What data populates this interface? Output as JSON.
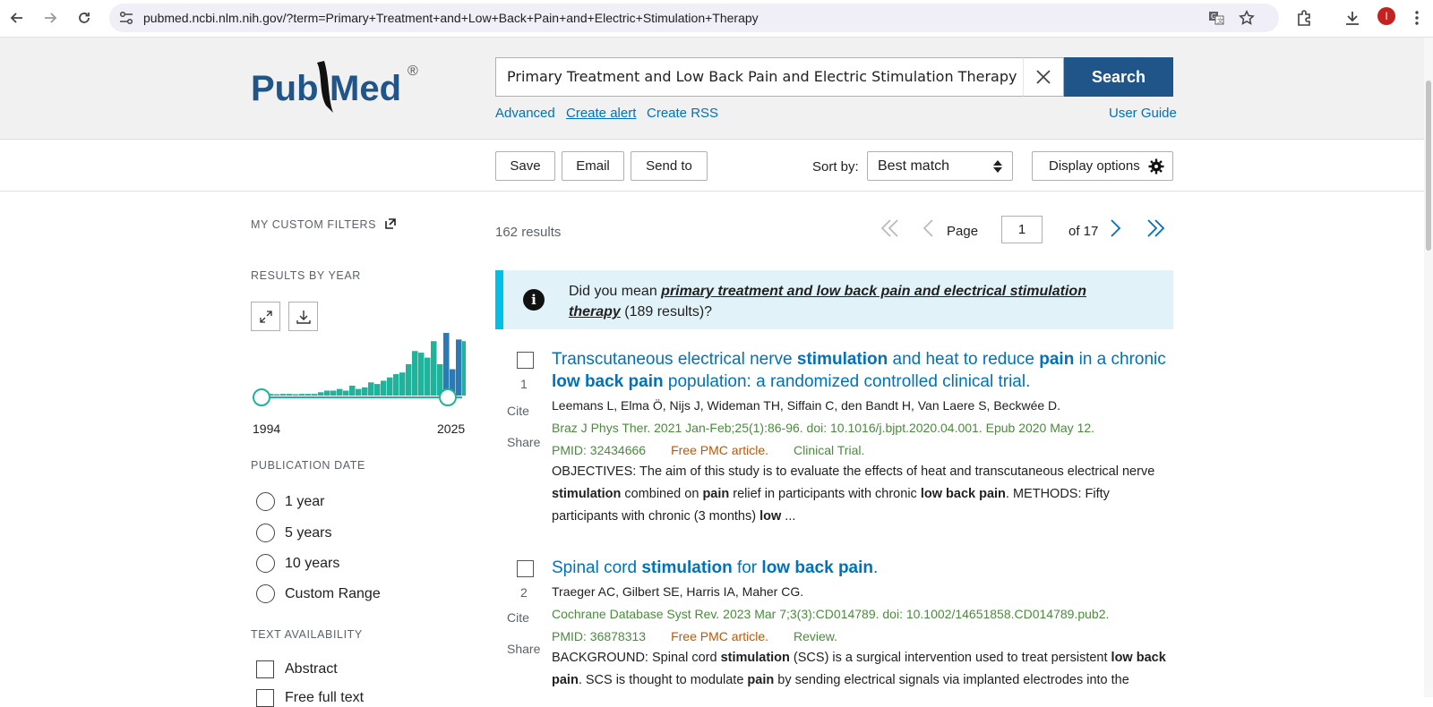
{
  "browser": {
    "url": "pubmed.ncbi.nlm.nih.gov/?term=Primary+Treatment+and+Low+Back+Pain+and+Electric+Stimulation+Therapy",
    "avatar_letter": "I"
  },
  "header": {
    "logo_pub": "Pub",
    "logo_med": "Med",
    "logo_reg": "®",
    "search_value": "Primary Treatment and Low Back Pain and Electric Stimulation Therapy",
    "search_button": "Search",
    "links": {
      "advanced": "Advanced",
      "create_alert": "Create alert",
      "create_rss": "Create RSS",
      "user_guide": "User Guide"
    }
  },
  "toolbar": {
    "save": "Save",
    "email": "Email",
    "send_to": "Send to",
    "sort_label": "Sort by:",
    "sort_value": "Best match",
    "display_options": "Display options"
  },
  "sidebar": {
    "custom_filters": "MY CUSTOM FILTERS",
    "results_by_year": "RESULTS BY YEAR",
    "year_start": "1994",
    "year_end": "2025",
    "histogram_counts": [
      0,
      1,
      0,
      1,
      1,
      0,
      1,
      1,
      1,
      2,
      3,
      3,
      4,
      3,
      6,
      4,
      5,
      8,
      7,
      9,
      11,
      13,
      14,
      19,
      27,
      26,
      23,
      33,
      19,
      38,
      16,
      34,
      33,
      12
    ],
    "publication_date": "PUBLICATION DATE",
    "date_options": [
      "1 year",
      "5 years",
      "10 years",
      "Custom Range"
    ],
    "text_availability": "TEXT AVAILABILITY",
    "text_options": [
      "Abstract",
      "Free full text"
    ]
  },
  "results": {
    "count": "162 results",
    "page_label": "Page",
    "page_value": "1",
    "page_of": "of 17",
    "suggestion": {
      "prefix": "Did you mean ",
      "link": "primary treatment and low back pain and electrical stimulation therapy",
      "suffix": " (189 results)?"
    },
    "articles": [
      {
        "number": "1",
        "title_parts": [
          {
            "t": "Transcutaneous electrical nerve ",
            "b": false
          },
          {
            "t": "stimulation",
            "b": true
          },
          {
            "t": " and heat to reduce ",
            "b": false
          },
          {
            "t": "pain",
            "b": true
          },
          {
            "t": " in a chronic ",
            "b": false
          },
          {
            "t": "low back pain",
            "b": true
          },
          {
            "t": " population: a randomized controlled clinical trial.",
            "b": false
          }
        ],
        "authors": "Leemans L, Elma Ö, Nijs J, Wideman TH, Siffain C, den Bandt H, Van Laere S, Beckwée D.",
        "journal": "Braz J Phys Ther. 2021 Jan-Feb;25(1):86-96. doi: 10.1016/j.bjpt.2020.04.001. Epub 2020 May 12.",
        "pmid": "PMID: 32434666",
        "free": "Free PMC article.",
        "type": "Clinical Trial.",
        "snippet_parts": [
          {
            "t": "OBJECTIVES: The aim of this study is to evaluate the effects of heat and transcutaneous electrical nerve ",
            "b": false
          },
          {
            "t": "stimulation",
            "b": true
          },
          {
            "t": " combined on ",
            "b": false
          },
          {
            "t": "pain",
            "b": true
          },
          {
            "t": " relief in participants with chronic ",
            "b": false
          },
          {
            "t": "low back pain",
            "b": true
          },
          {
            "t": ". METHODS: Fifty participants with chronic (3 months) ",
            "b": false
          },
          {
            "t": "low",
            "b": true
          },
          {
            "t": " ...",
            "b": false
          }
        ]
      },
      {
        "number": "2",
        "title_parts": [
          {
            "t": "Spinal cord ",
            "b": false
          },
          {
            "t": "stimulation",
            "b": true
          },
          {
            "t": " for ",
            "b": false
          },
          {
            "t": "low back pain",
            "b": true
          },
          {
            "t": ".",
            "b": false
          }
        ],
        "authors": "Traeger AC, Gilbert SE, Harris IA, Maher CG.",
        "journal": "Cochrane Database Syst Rev. 2023 Mar 7;3(3):CD014789. doi: 10.1002/14651858.CD014789.pub2.",
        "pmid": "PMID: 36878313",
        "free": "Free PMC article.",
        "type": "Review.",
        "snippet_parts": [
          {
            "t": "BACKGROUND: Spinal cord ",
            "b": false
          },
          {
            "t": "stimulation",
            "b": true
          },
          {
            "t": " (SCS) is a surgical intervention used to treat persistent ",
            "b": false
          },
          {
            "t": "low back pain",
            "b": true
          },
          {
            "t": ". SCS is thought to modulate ",
            "b": false
          },
          {
            "t": "pain",
            "b": true
          },
          {
            "t": " by sending electrical signals via implanted electrodes into the",
            "b": false
          }
        ]
      }
    ],
    "cite_label": "Cite",
    "share_label": "Share"
  },
  "colors": {
    "brand": "#20558a",
    "link": "#0071bc",
    "hist": "#20b29a",
    "hist_highlight": "#2a7ab5"
  }
}
